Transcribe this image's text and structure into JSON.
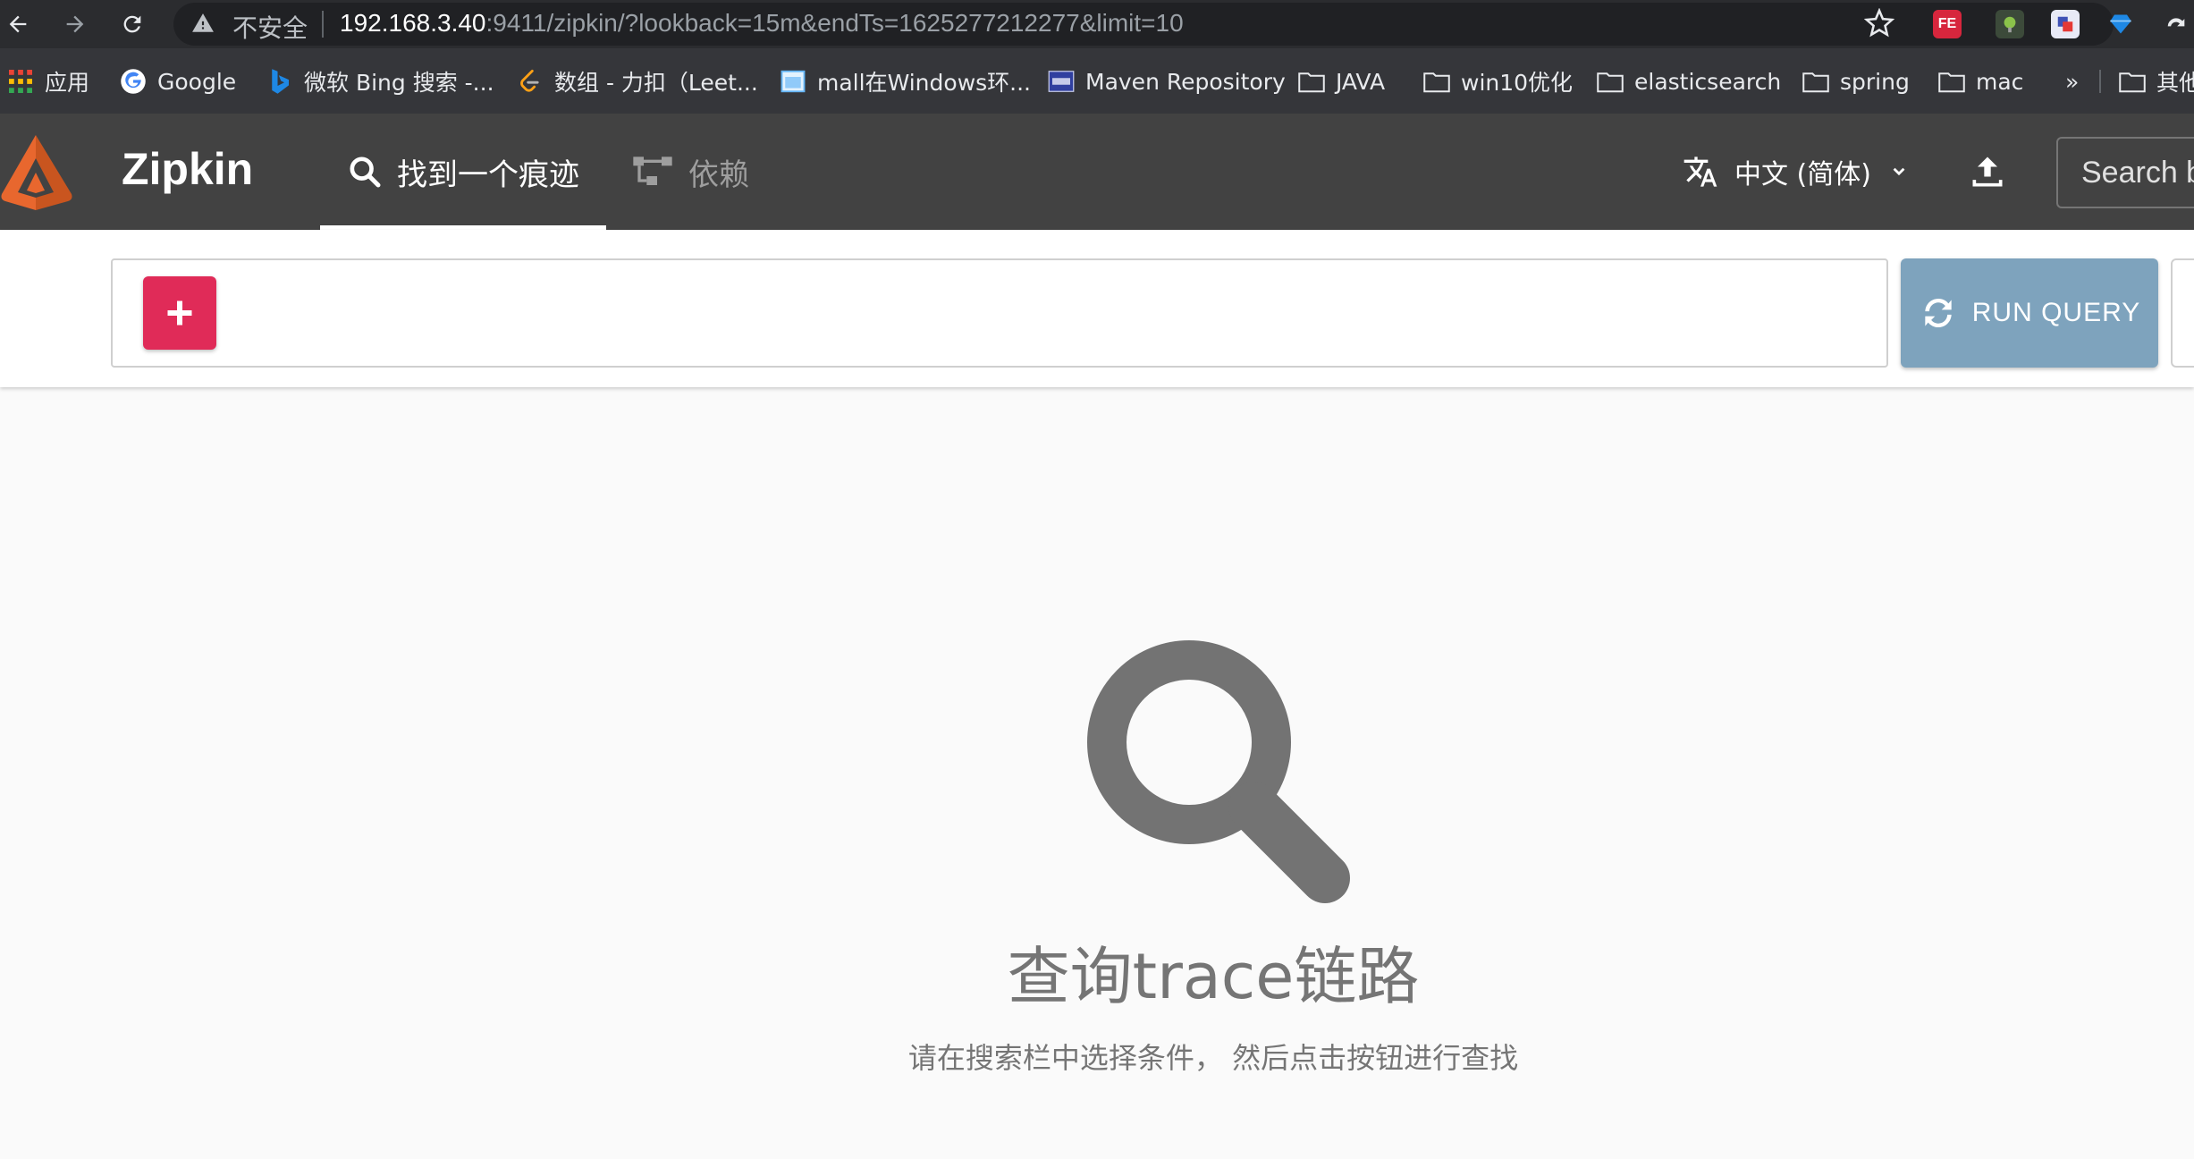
{
  "browser": {
    "insecure_label": "不安全",
    "url_host": "192.168.3.40",
    "url_rest": ":9411/zipkin/?lookback=15m&endTs=1625277212277&limit=10",
    "bookmarks": [
      {
        "label": "应用",
        "icon": "apps-grid-icon"
      },
      {
        "label": "Google",
        "icon": "google-icon"
      },
      {
        "label": "微软 Bing 搜索 -...",
        "icon": "bing-icon"
      },
      {
        "label": "数组 - 力扣（Leet...",
        "icon": "leetcode-icon"
      },
      {
        "label": "mall在Windows环...",
        "icon": "page-icon"
      },
      {
        "label": "Maven Repository",
        "icon": "maven-icon"
      },
      {
        "label": "JAVA",
        "icon": "folder-icon"
      },
      {
        "label": "win10优化",
        "icon": "folder-icon"
      },
      {
        "label": "elasticsearch",
        "icon": "folder-icon"
      },
      {
        "label": "spring",
        "icon": "folder-icon"
      },
      {
        "label": "mac",
        "icon": "folder-icon"
      },
      {
        "label": "»",
        "icon": ""
      },
      {
        "label": "其他",
        "icon": "folder-icon"
      }
    ]
  },
  "app": {
    "brand": "Zipkin",
    "tabs": [
      {
        "label": "找到一个痕迹",
        "icon": "search-icon",
        "active": true
      },
      {
        "label": "依赖",
        "icon": "dependency-graph-icon",
        "active": false
      }
    ],
    "language": "中文 (简体)",
    "search_placeholder": "Search by trace ID",
    "accent_color": "#e02b58",
    "header_color": "#424242"
  },
  "query": {
    "run_label": "RUN QUERY"
  },
  "empty_state": {
    "title": "查询trace链路",
    "description": "请在搜索栏中选择条件， 然后点击按钮进行查找"
  }
}
